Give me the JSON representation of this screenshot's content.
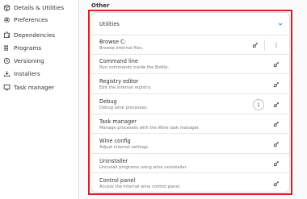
{
  "sidebar": {
    "items": [
      {
        "label": "Details & Utilities",
        "icon": "package-icon"
      },
      {
        "label": "Preferences",
        "icon": "gear-icon"
      },
      {
        "label": "Dependencies",
        "icon": "puzzle-icon"
      },
      {
        "label": "Programs",
        "icon": "grid-icon"
      },
      {
        "label": "Versioning",
        "icon": "history-icon"
      },
      {
        "label": "Installers",
        "icon": "download-icon"
      },
      {
        "label": "Task manager",
        "icon": "monitor-icon"
      }
    ]
  },
  "main": {
    "section_title": "Other",
    "header": {
      "label": "Utilities"
    },
    "rows": [
      {
        "title": "Browse C:",
        "subtitle": "Browse internal files."
      },
      {
        "title": "Command line",
        "subtitle": "Run commands inside the Bottle."
      },
      {
        "title": "Registry editor",
        "subtitle": "Edit the internal registry."
      },
      {
        "title": "Debug",
        "subtitle": "Debug wine processes."
      },
      {
        "title": "Task manager",
        "subtitle": "Manage processes with the Wine task manager."
      },
      {
        "title": "Wine config",
        "subtitle": "Adjust internal settings."
      },
      {
        "title": "Uninstaller",
        "subtitle": "Uninstall programs using wine uninstaller."
      },
      {
        "title": "Control panel",
        "subtitle": "Access the internal wine control panel."
      }
    ]
  },
  "colors": {
    "accent": "#3584e4",
    "highlight": "#e01b24"
  }
}
